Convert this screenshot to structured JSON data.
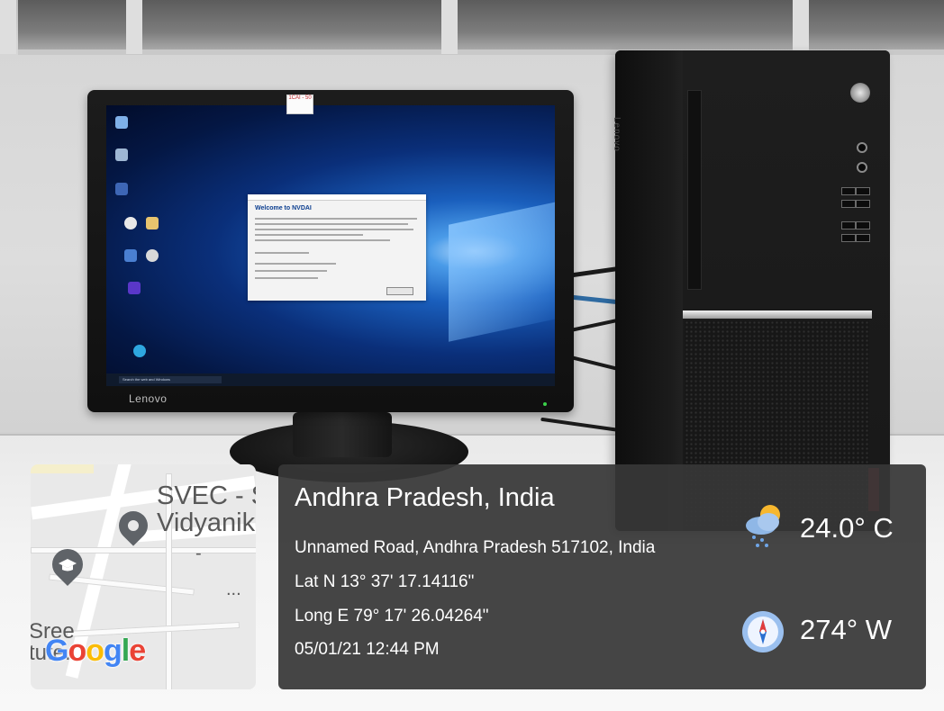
{
  "photo": {
    "monitor_brand": "Lenovo",
    "monitor_sticky_note": "1CAI - 50",
    "screen_dialog_title": "Welcome to NVDAI",
    "taskbar_search": "Search the web and Windows"
  },
  "overlay": {
    "map": {
      "place_label": "SVEC - S\nVidyanik",
      "dash_label": "-",
      "ellipsis": "...",
      "bottom_label": "Sree\ntute...",
      "logo": "Google"
    },
    "location": {
      "title": "Andhra Pradesh, India",
      "address": "Unnamed Road, Andhra Pradesh 517102, India",
      "latitude": "Lat N 13° 37' 17.14116\"",
      "longitude": "Long E 79° 17' 26.04264\"",
      "datetime": "05/01/21 12:44 PM"
    },
    "weather": {
      "icon": "partly-cloudy-rain-icon",
      "temperature": "24.0° C"
    },
    "compass": {
      "icon": "compass-icon",
      "direction": "274° W"
    }
  }
}
